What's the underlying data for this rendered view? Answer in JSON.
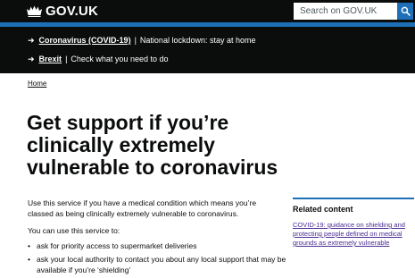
{
  "header": {
    "logo_text": "GOV.UK",
    "search_placeholder": "Search on GOV.UK"
  },
  "notices": [
    {
      "link": "Coronavirus (COVID-19)",
      "separator": "|",
      "text": "National lockdown: stay at home"
    },
    {
      "link": "Brexit",
      "separator": "|",
      "text": "Check what you need to do"
    }
  ],
  "breadcrumb": "Home",
  "title": "Get support if you’re clinically extremely vulnerable to coronavirus",
  "intro": "Use this service if you have a medical condition which means you’re classed as being clinically extremely vulnerable to coronavirus.",
  "you_can": "You can use this service to:",
  "bullets": [
    "ask for priority access to supermarket deliveries",
    "ask your local authority to contact you about any local support that may be available if you’re ‘shielding’"
  ],
  "related": {
    "heading": "Related content",
    "link": "COVID-19: guidance on shielding and protecting people defined on medical grounds as extremely vulnerable"
  },
  "colors": {
    "header_bg": "#0b0c0c",
    "brand_blue": "#1d70b8",
    "visited_link": "#4c2c92"
  },
  "icons": {
    "logo": "crown-icon",
    "search": "search-icon",
    "notice": "arrow-right-icon"
  }
}
